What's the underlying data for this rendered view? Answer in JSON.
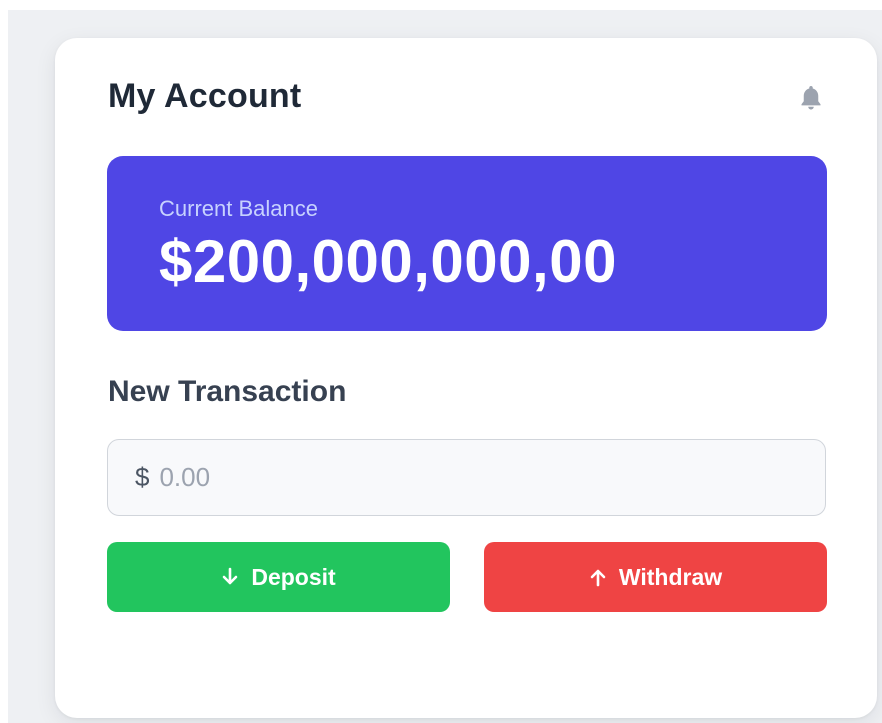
{
  "account": {
    "title": "My Account",
    "notification_icon": "bell-icon"
  },
  "balance": {
    "label": "Current Balance",
    "amount": "$200,000,000,00"
  },
  "transaction": {
    "section_title": "New Transaction",
    "currency_symbol": "$",
    "amount_placeholder": "0.00",
    "deposit_label": "Deposit",
    "deposit_icon": "arrow-down-icon",
    "withdraw_label": "Withdraw",
    "withdraw_icon": "arrow-up-icon"
  },
  "colors": {
    "balance_card": "#4f46e5",
    "deposit": "#22c55e",
    "withdraw": "#ef4444"
  }
}
